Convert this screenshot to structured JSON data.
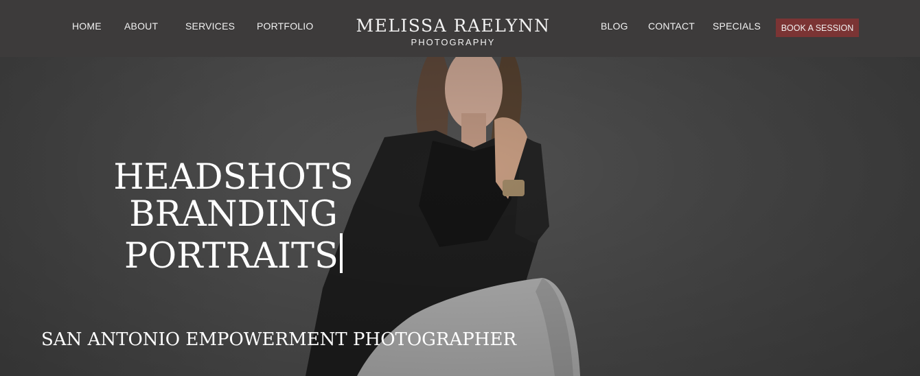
{
  "nav": {
    "left_links": [
      "HOME",
      "ABOUT",
      "SERVICES",
      "PORTFOLIO"
    ],
    "right_links": [
      "BLOG",
      "CONTACT",
      "SPECIALS"
    ],
    "book_button": "BOOK A SESSION"
  },
  "logo": {
    "name": "MELISSA RAELYNN",
    "subtitle": "PHOTOGRAPHY"
  },
  "hero": {
    "lines": [
      "HEADSHOTS",
      "BRANDING",
      "PORTRAITS"
    ],
    "tagline": "SAN ANTONIO EMPOWERMENT PHOTOGRAPHER"
  },
  "colors": {
    "nav_background": "#3d3b3b",
    "button_background": "#7b3434",
    "hero_background": "#4b4b4b",
    "text": "#ffffff"
  }
}
